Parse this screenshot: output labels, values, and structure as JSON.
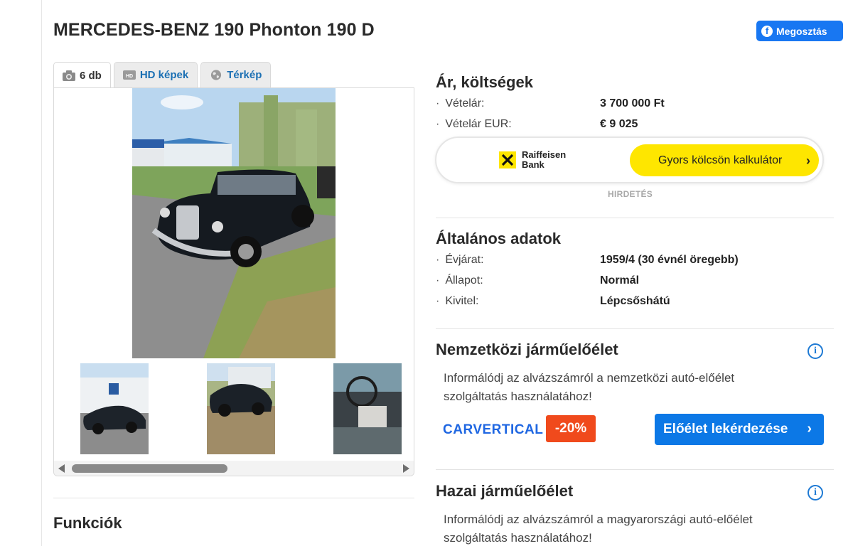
{
  "title": "MERCEDES-BENZ 190 Phonton 190 D",
  "share_button": "Megosztás",
  "gallery": {
    "tabs": [
      {
        "label": "6 db",
        "icon": "camera-icon"
      },
      {
        "label": "HD képek",
        "icon": "hd-icon"
      },
      {
        "label": "Térkép",
        "icon": "globe-icon"
      }
    ],
    "main_image": "Black Mercedes-Benz 190 D parked on gravel",
    "thumbnails": [
      "Car in front of blue building",
      "Car rear view",
      "Car interior"
    ]
  },
  "features_title": "Funkciók",
  "prices": {
    "title": "Ár, költségek",
    "rows": [
      {
        "label": "Vételár:",
        "value": "3 700 000 Ft"
      },
      {
        "label": "Vételár EUR:",
        "value": "€ 9 025"
      }
    ]
  },
  "bank": {
    "name_line1": "Raiffeisen",
    "name_line2": "Bank",
    "calc_button": "Gyors kölcsön kalkulátor",
    "ad_label": "HIRDETÉS",
    "brand_color": "#fee600"
  },
  "general": {
    "title": "Általános adatok",
    "rows": [
      {
        "label": "Évjárat:",
        "value": "1959/4 (30 évnél öregebb)"
      },
      {
        "label": "Állapot:",
        "value": "Normál"
      },
      {
        "label": "Kivitel:",
        "value": "Lépcsőshátú"
      }
    ]
  },
  "intl_history": {
    "title": "Nemzetközi járműelőélet",
    "text_line1": "Informálódj az alvázszámról a nemzetközi autó-előélet",
    "text_line2": "szolgáltatás használatához!",
    "logo": "CARVERTICAL",
    "discount": "-20%",
    "button": "Előélet lekérdezése"
  },
  "home_history": {
    "title": "Hazai járműelőélet",
    "text_line1": "Informálódj az alvázszámról a magyarországi autó-előélet",
    "text_line2": "szolgáltatás használatához!"
  }
}
